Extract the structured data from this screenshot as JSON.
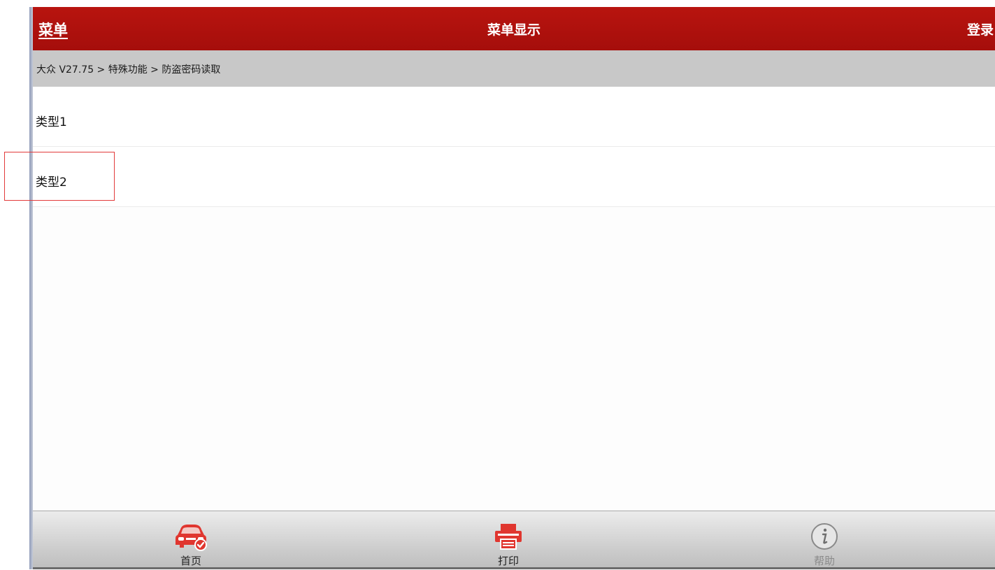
{
  "titlebar": {
    "menu_label": "菜单",
    "title": "菜单显示",
    "login_label": "登录"
  },
  "breadcrumb": "大众 V27.75 > 特殊功能 > 防盗密码读取",
  "items": [
    {
      "label": "类型1"
    },
    {
      "label": "类型2"
    }
  ],
  "toolbar": {
    "home_label": "首页",
    "print_label": "打印",
    "help_label": "帮助"
  },
  "icons": {
    "home": "car-check-icon",
    "print": "printer-icon",
    "help": "info-icon"
  },
  "colors": {
    "titlebar": "#b8140f",
    "breadcrumb_bg": "#c8c8c8",
    "accent": "#e0362f",
    "highlight_box": "#e23b3b"
  }
}
